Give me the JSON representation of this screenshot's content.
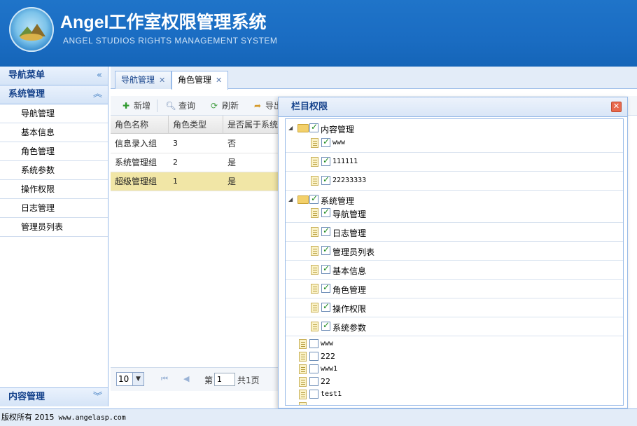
{
  "header": {
    "title": "Angel工作室权限管理系统",
    "subtitle": "ANGEL STUDIOS RIGHTS MANAGEMENT SYSTEM"
  },
  "sidebar": {
    "nav_header": "导航菜单",
    "section_title": "系统管理",
    "items": [
      {
        "label": "导航管理"
      },
      {
        "label": "基本信息"
      },
      {
        "label": "角色管理"
      },
      {
        "label": "系统参数"
      },
      {
        "label": "操作权限"
      },
      {
        "label": "日志管理"
      },
      {
        "label": "管理员列表"
      }
    ],
    "bottom_section": "内容管理",
    "collapse_icon": "double-chevron-left-icon"
  },
  "tabs": [
    {
      "label": "导航管理",
      "active": false
    },
    {
      "label": "角色管理",
      "active": true
    }
  ],
  "toolbar": {
    "add_label": "新增",
    "search_label": "查询",
    "refresh_label": "刷新",
    "export_label": "导出"
  },
  "grid": {
    "columns": [
      "角色名称",
      "角色类型",
      "是否属于系统"
    ],
    "rows": [
      {
        "name": "信息录入组",
        "type": "3",
        "system": "否",
        "selected": false
      },
      {
        "name": "系统管理组",
        "type": "2",
        "system": "是",
        "selected": false
      },
      {
        "name": "超级管理组",
        "type": "1",
        "system": "是",
        "selected": true
      }
    ]
  },
  "pager": {
    "page_size": "10",
    "page_prefix": "第",
    "page_value": "1",
    "total_pages": "共1页"
  },
  "dialog": {
    "title": "栏目权限",
    "tree": {
      "group1": {
        "label": "内容管理",
        "children": [
          {
            "label": "www"
          },
          {
            "label": "111111"
          },
          {
            "label": "22233333"
          }
        ]
      },
      "group2": {
        "label": "系统管理",
        "children": [
          {
            "label": "导航管理"
          },
          {
            "label": "日志管理"
          },
          {
            "label": "管理员列表"
          },
          {
            "label": "基本信息"
          },
          {
            "label": "角色管理"
          },
          {
            "label": "操作权限"
          },
          {
            "label": "系统参数"
          }
        ]
      },
      "unchecked": [
        {
          "label": "www"
        },
        {
          "label": "222"
        },
        {
          "label": "www1"
        },
        {
          "label": "22"
        },
        {
          "label": "test1"
        }
      ]
    }
  },
  "footer": {
    "copyright": "版权所有 2015",
    "url": "www.angelasp.com"
  }
}
